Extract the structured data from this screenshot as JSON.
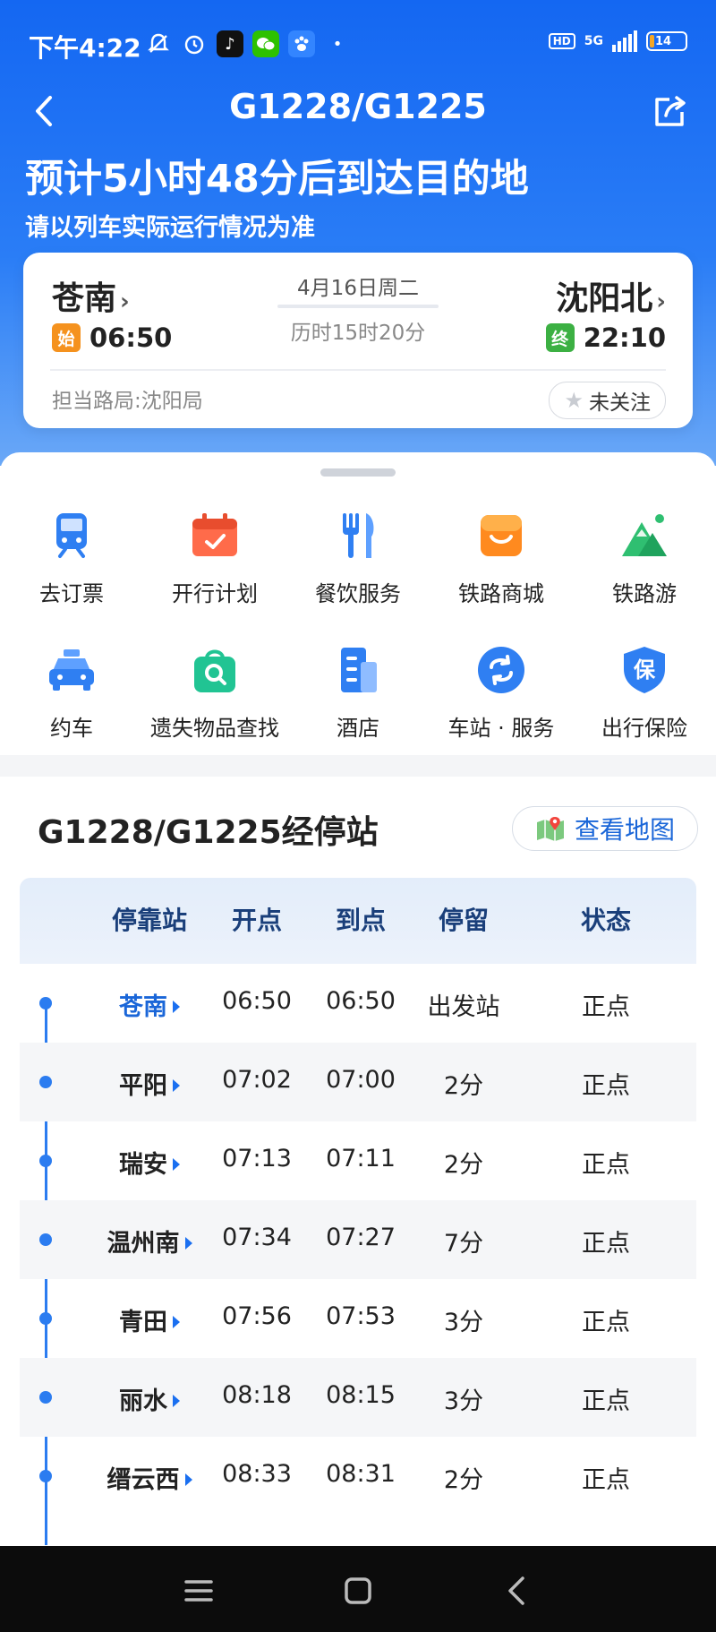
{
  "status_bar": {
    "time": "下午4:22",
    "network": "5G",
    "hd": "HD",
    "battery": "14",
    "battery_level": 0.14
  },
  "header": {
    "title": "G1228/G1225"
  },
  "eta": {
    "headline": "预计5小时48分后到达目的地",
    "note": "请以列车实际运行情况为准"
  },
  "trip": {
    "from_station": "苍南",
    "from_badge": "始",
    "from_time": "06:50",
    "date": "4月16日周二",
    "duration": "历时15时20分",
    "to_station": "沈阳北",
    "to_badge": "终",
    "to_time": "22:10",
    "bureau": "担当路局:沈阳局",
    "follow_label": "未关注"
  },
  "services": [
    {
      "label": "去订票",
      "icon": "train-icon"
    },
    {
      "label": "开行计划",
      "icon": "calendar-icon"
    },
    {
      "label": "餐饮服务",
      "icon": "fork-knife-icon"
    },
    {
      "label": "铁路商城",
      "icon": "shop-icon"
    },
    {
      "label": "铁路游",
      "icon": "mountain-icon"
    },
    {
      "label": "约车",
      "icon": "taxi-icon"
    },
    {
      "label": "遗失物品查找",
      "icon": "lost-bag-icon"
    },
    {
      "label": "酒店",
      "icon": "hotel-icon"
    },
    {
      "label": "车站 · 服务",
      "icon": "station-service-icon"
    },
    {
      "label": "出行保险",
      "icon": "insurance-shield-icon",
      "glyph": "保"
    }
  ],
  "stops_section": {
    "title": "G1228/G1225经停站",
    "map_label": "查看地图"
  },
  "table": {
    "headers": [
      "停靠站",
      "开点",
      "到点",
      "停留",
      "状态"
    ],
    "rows": [
      {
        "station": "苍南",
        "depart": "06:50",
        "arrive": "06:50",
        "stay": "出发站",
        "status": "正点"
      },
      {
        "station": "平阳",
        "depart": "07:02",
        "arrive": "07:00",
        "stay": "2分",
        "status": "正点"
      },
      {
        "station": "瑞安",
        "depart": "07:13",
        "arrive": "07:11",
        "stay": "2分",
        "status": "正点"
      },
      {
        "station": "温州南",
        "depart": "07:34",
        "arrive": "07:27",
        "stay": "7分",
        "status": "正点"
      },
      {
        "station": "青田",
        "depart": "07:56",
        "arrive": "07:53",
        "stay": "3分",
        "status": "正点"
      },
      {
        "station": "丽水",
        "depart": "08:18",
        "arrive": "08:15",
        "stay": "3分",
        "status": "正点"
      },
      {
        "station": "缙云西",
        "depart": "08:33",
        "arrive": "08:31",
        "stay": "2分",
        "status": "正点"
      }
    ]
  },
  "colors": {
    "primary": "#1467f2",
    "accent_blue": "#1a66d8",
    "start_badge": "#f5921e",
    "end_badge": "#3cb043",
    "status_on_time": "#222222"
  }
}
